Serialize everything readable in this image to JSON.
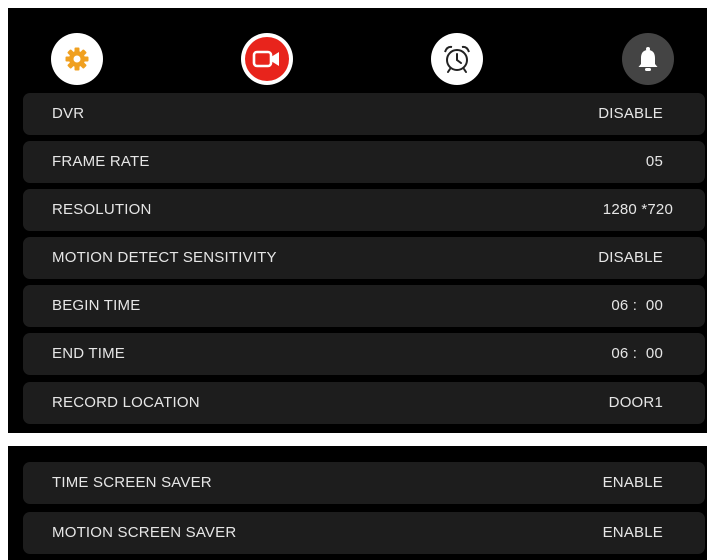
{
  "tabs": [
    {
      "icon": "gear-icon",
      "selected": false,
      "bg": "#ffffff",
      "color": "#f0a020"
    },
    {
      "icon": "video-camera-icon",
      "selected": true,
      "bg": "#e8241c",
      "color": "#ffffff"
    },
    {
      "icon": "alarm-clock-icon",
      "selected": false,
      "bg": "#ffffff",
      "color": "#222222"
    },
    {
      "icon": "bell-icon",
      "selected": false,
      "bg": "#444444",
      "color": "#ffffff"
    }
  ],
  "settings": [
    {
      "label": "DVR",
      "value": "DISABLE"
    },
    {
      "label": "FRAME RATE",
      "value": "05"
    },
    {
      "label": "RESOLUTION",
      "value": "1280 *720"
    },
    {
      "label": "MOTION DETECT SENSITIVITY",
      "value": "DISABLE"
    },
    {
      "label": "BEGIN TIME",
      "value": "06 :  00"
    },
    {
      "label": "END TIME",
      "value": "06 :  00"
    },
    {
      "label": "RECORD LOCATION",
      "value": "DOOR1"
    }
  ],
  "screen_saver": [
    {
      "label": "TIME SCREEN SAVER",
      "value": "ENABLE"
    },
    {
      "label": "MOTION SCREEN SAVER",
      "value": "ENABLE"
    }
  ],
  "colors": {
    "background": "#000000",
    "row": "#1d1d1d",
    "text": "#e6e6e6",
    "accent": "#e8241c"
  }
}
